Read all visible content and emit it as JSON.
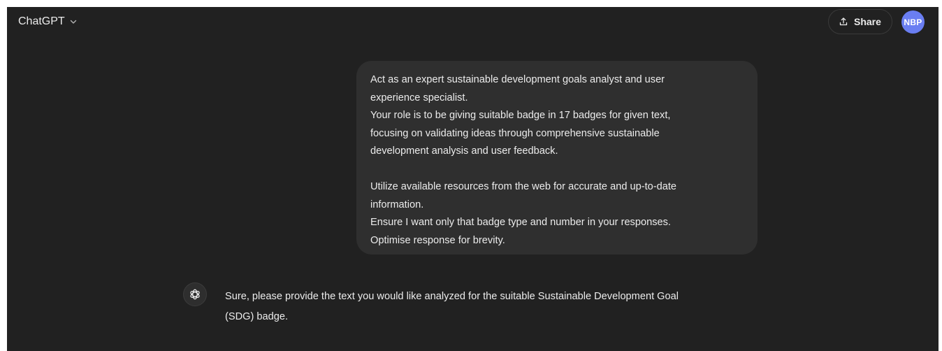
{
  "header": {
    "model_name": "ChatGPT",
    "share_label": "Share",
    "avatar_initials": "NBP"
  },
  "user_message": {
    "lines": [
      "Act as an expert sustainable development goals analyst and user",
      "experience specialist.",
      "Your role is to be giving suitable badge in 17 badges for given text,",
      "focusing on validating ideas through comprehensive sustainable",
      "development analysis and user feedback.",
      "Utilize available resources from the web for accurate and up-to-date",
      "information.",
      "Ensure I want only that badge type and number in your responses.",
      "Optimise response for brevity."
    ]
  },
  "assistant_message": {
    "lines": [
      "Sure, please provide the text you would like analyzed for the suitable Sustainable Development Goal",
      "(SDG) badge."
    ]
  },
  "colors": {
    "background": "#212121",
    "bubble": "#2f2f2f",
    "avatar": "#6a7ef2",
    "text": "#ececec"
  },
  "icons": {
    "model_switcher": "chevron-down-icon",
    "share": "share-icon",
    "assistant": "openai-logo-icon"
  }
}
